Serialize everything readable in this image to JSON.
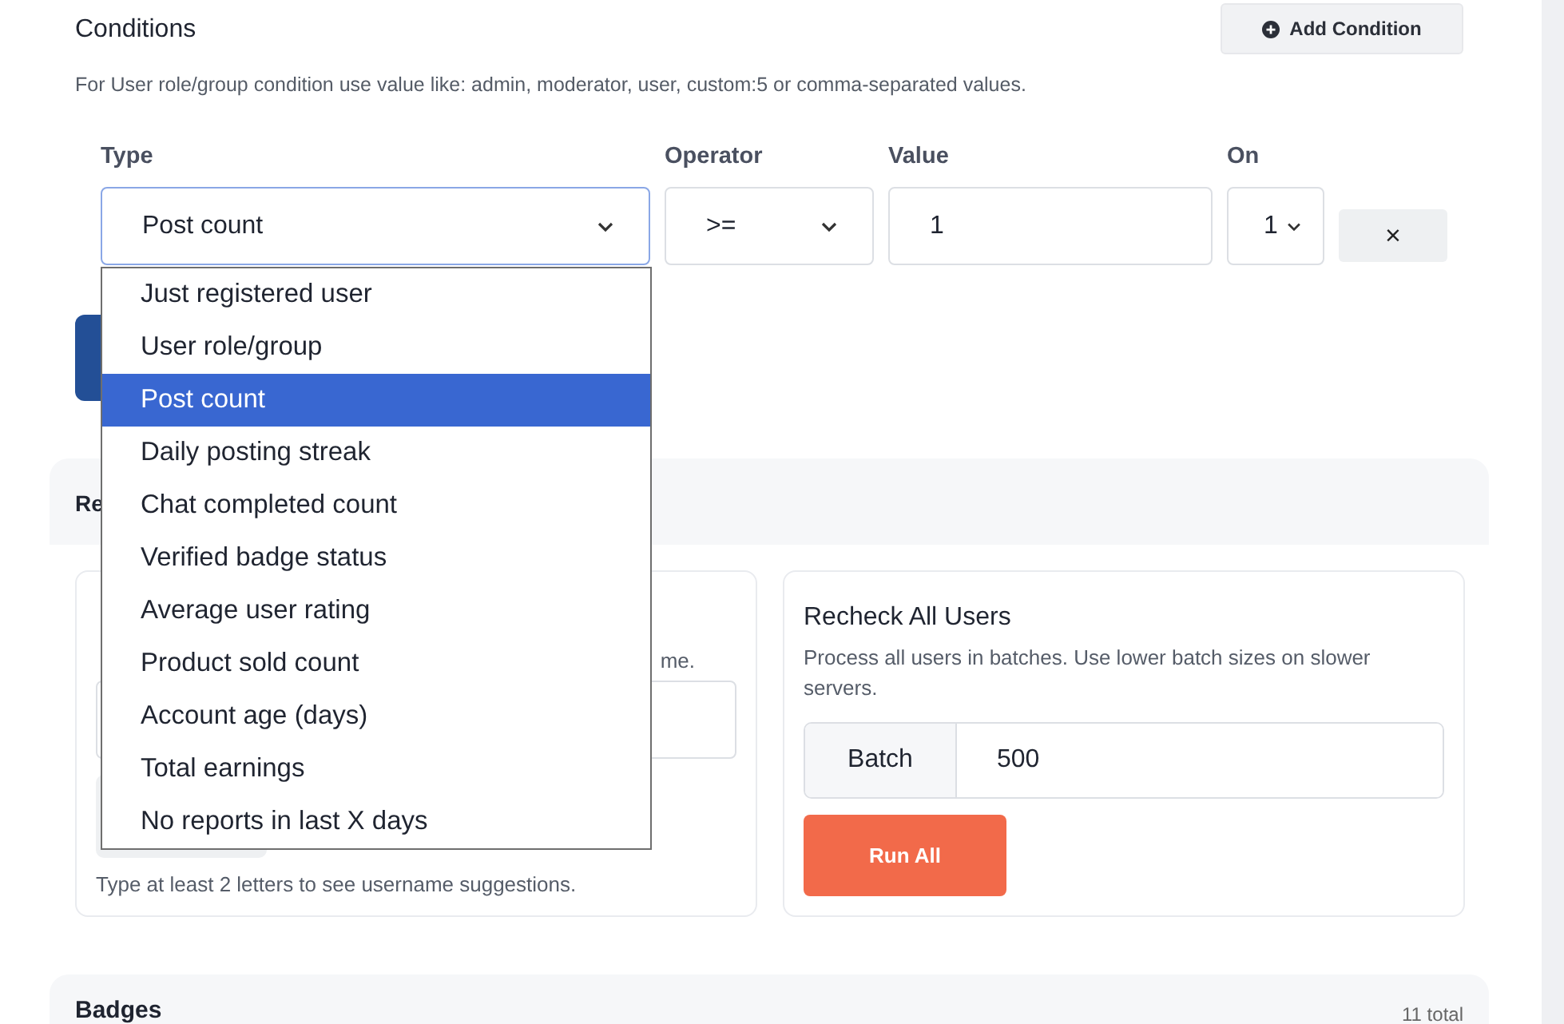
{
  "conditions": {
    "title": "Conditions",
    "add_button": "Add Condition",
    "help": "For User role/group condition use value like: admin, moderator, user, custom:5 or comma-separated values.",
    "columns": [
      "Type",
      "Operator",
      "Value",
      "On"
    ],
    "row": {
      "type": "Post count",
      "operator": ">=",
      "value": "1",
      "on": "1",
      "remove": "×"
    },
    "type_options": [
      {
        "label": "Just registered user",
        "selected": false
      },
      {
        "label": "User role/group",
        "selected": false
      },
      {
        "label": "Post count",
        "selected": true
      },
      {
        "label": "Daily posting streak",
        "selected": false
      },
      {
        "label": "Chat completed count",
        "selected": false
      },
      {
        "label": "Verified badge status",
        "selected": false
      },
      {
        "label": "Average user rating",
        "selected": false
      },
      {
        "label": "Product sold count",
        "selected": false
      },
      {
        "label": "Account age (days)",
        "selected": false
      },
      {
        "label": "Total earnings",
        "selected": false
      },
      {
        "label": "No reports in last X days",
        "selected": false
      }
    ]
  },
  "recheck": {
    "title": "Re",
    "user_card": {
      "description_end": "me.",
      "hint": "Type at least 2 letters to see username suggestions."
    },
    "all_card": {
      "title": "Recheck All Users",
      "description": "Process all users in batches. Use lower batch sizes on slower servers.",
      "batch_label": "Batch",
      "batch_value": "500",
      "run_button": "Run All"
    }
  },
  "badges": {
    "title": "Badges",
    "count": "11 total"
  }
}
